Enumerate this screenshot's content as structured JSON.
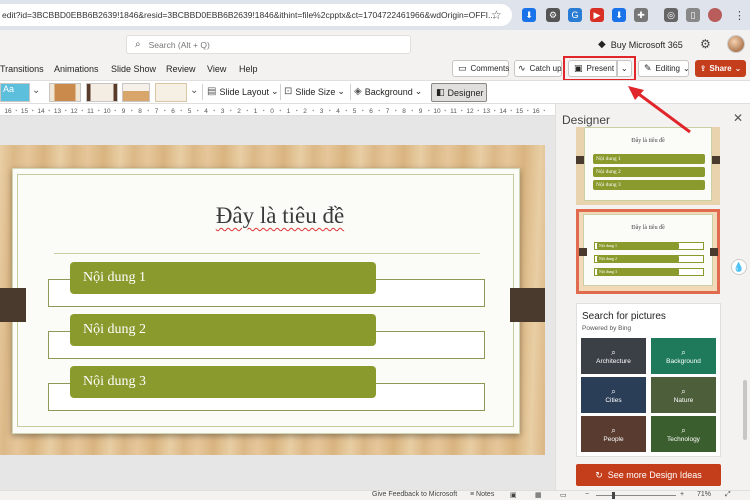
{
  "browser": {
    "url": "edit?id=3BCBBD0EBB6B2639!1846&resid=3BCBBD0EBB6B2639!1846&ithint=file%2cpptx&ct=1704722461966&wdOrigin=OFFI..."
  },
  "header": {
    "search_placeholder": "Search (Alt + Q)",
    "buy_label": "Buy Microsoft 365"
  },
  "ribbon": {
    "tabs": [
      "Transitions",
      "Animations",
      "Slide Show",
      "Review",
      "View",
      "Help"
    ],
    "comments_label": "Comments",
    "catchup_label": "Catch up",
    "present_label": "Present",
    "editing_label": "Editing",
    "share_label": "Share",
    "theme_thumb_label": "Aa",
    "slide_layout_label": "Slide Layout",
    "slide_size_label": "Slide Size",
    "background_label": "Background",
    "designer_label": "Designer"
  },
  "ruler": {
    "numbers": [
      "16",
      "15",
      "14",
      "13",
      "12",
      "11",
      "10",
      "9",
      "8",
      "7",
      "6",
      "5",
      "4",
      "3",
      "2",
      "1",
      "0",
      "1",
      "2",
      "3",
      "4",
      "5",
      "6",
      "7",
      "8",
      "9",
      "10",
      "11",
      "12",
      "13",
      "14",
      "15",
      "16"
    ]
  },
  "slide": {
    "title": "Đây là tiêu đề",
    "items": [
      "Nội dung 1",
      "Nội dung 2",
      "Nội dung 3"
    ]
  },
  "designer": {
    "title": "Designer",
    "thumb1_title": "Đây là tiêu đề",
    "thumb1_items": [
      "Nội dung 1",
      "Nội dung 2",
      "Nội dung 3"
    ],
    "thumb2_title": "Đây là tiêu đề",
    "thumb2_items": [
      "Nội dung 1",
      "Nội dung 2",
      "Nội dung 3"
    ],
    "pictures_title": "Search for pictures",
    "pictures_sub": "Powered by Bing",
    "pictures": [
      {
        "label": "Architecture",
        "color": "#3b3f46"
      },
      {
        "label": "Background",
        "color": "#1f7a5c"
      },
      {
        "label": "Cities",
        "color": "#2b3e57"
      },
      {
        "label": "Nature",
        "color": "#4d5e3a"
      },
      {
        "label": "People",
        "color": "#5a3b30"
      },
      {
        "label": "Technology",
        "color": "#3b5e2e"
      }
    ],
    "see_more_label": "See more Design Ideas"
  },
  "status": {
    "feedback": "Give Feedback to Microsoft",
    "notes": "Notes",
    "zoom": "71%"
  },
  "colors": {
    "accent_green": "#8a9a2d",
    "share_red": "#c43e1c",
    "highlight_red": "#e0262b"
  }
}
